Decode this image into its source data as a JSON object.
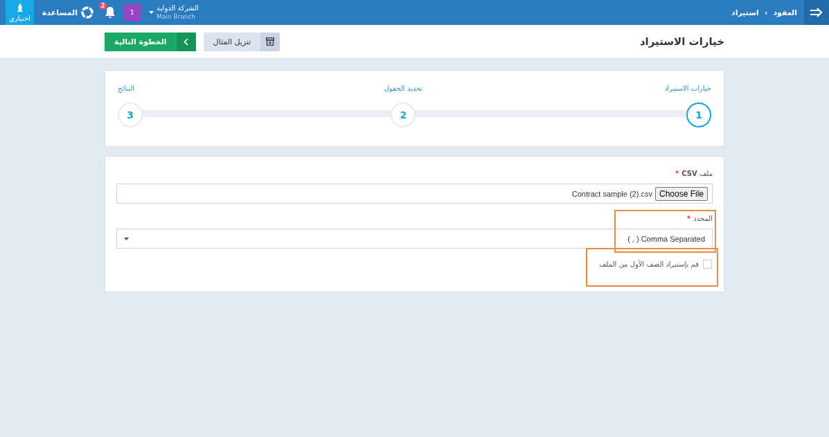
{
  "topbar": {
    "breadcrumb": [
      "العقود",
      "استيراد"
    ],
    "breadcrumb_separator": "›",
    "optional_tab": {
      "label": "اختياري",
      "selected": true
    },
    "help": {
      "label": "المساعدة"
    },
    "notifications": {
      "count": "2"
    },
    "user_badge": "1",
    "company": {
      "name": "الشركة الدولية",
      "branch": "Main Branch"
    }
  },
  "page_header": {
    "title": "خيارات الاستيراد",
    "buttons": [
      {
        "kind": "secondary",
        "label": "تنزيل المثال"
      },
      {
        "kind": "primary",
        "label": "الخطوة التالية"
      }
    ]
  },
  "steps": [
    {
      "number": "1",
      "label": "خيارات الاستيراد",
      "selected": true
    },
    {
      "number": "2",
      "label": "تحديد الحقول",
      "selected": false
    },
    {
      "number": "3",
      "label": "النتائج",
      "selected": false
    }
  ],
  "form": {
    "file_field": {
      "label": "ملف **CSV**",
      "required": true,
      "required_mark": "*",
      "button": "Choose File",
      "value": "Contract sample (2).csv"
    },
    "delimiter_field": {
      "label": "المحدد",
      "required": true,
      "required_mark": "*",
      "value": "( , ) Comma Separated",
      "highlighted": true
    },
    "first_row_checkbox": {
      "label": "قم بإستيراد الصف الأول من الملف",
      "checked": false,
      "highlighted": true
    }
  }
}
